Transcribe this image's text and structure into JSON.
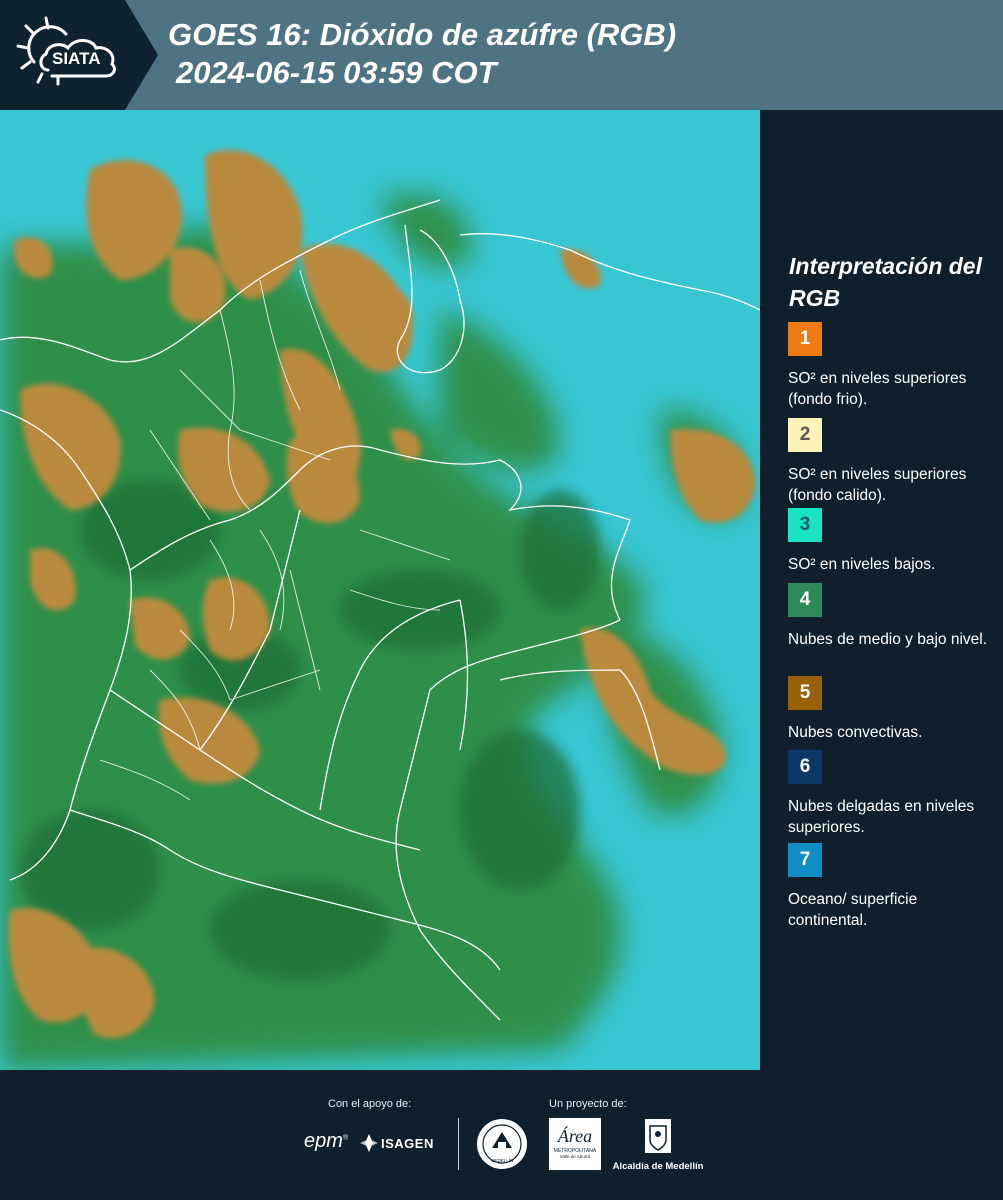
{
  "header": {
    "logo_text": "SIATA",
    "title_line1": "GOES 16: Dióxido de azúfre (RGB)",
    "title_line2": "2024-06-15 03:59 COT"
  },
  "legend": {
    "title": "Interpretación del RGB",
    "items": [
      {
        "number": "1",
        "color": "#f07a12",
        "text_color": "#ffffff",
        "description": "SO² en niveles superiores (fondo frio)."
      },
      {
        "number": "2",
        "color": "#fbf3b8",
        "text_color": "#5a5a5a",
        "description": "SO² en niveles superiores (fondo calido)."
      },
      {
        "number": "3",
        "color": "#18e3c5",
        "text_color": "#1b5e66",
        "description": "SO² en niveles bajos."
      },
      {
        "number": "4",
        "color": "#2f8a58",
        "text_color": "#ffffff",
        "description": "Nubes de medio y bajo nivel."
      },
      {
        "number": "5",
        "color": "#99600c",
        "text_color": "#ffffff",
        "description": "Nubes convectivas."
      },
      {
        "number": "6",
        "color": "#0d3767",
        "text_color": "#ffffff",
        "description": "Nubes delgadas en niveles superiores."
      },
      {
        "number": "7",
        "color": "#0f8dc4",
        "text_color": "#ffffff",
        "description": "Oceano/ superficie continental."
      }
    ]
  },
  "footer": {
    "support_label": "Con el apoyo de:",
    "project_label": "Un proyecto de:",
    "logo_epm": "epm",
    "logo_isagen": "ISAGEN",
    "logo_area_main": "Área",
    "logo_area_sub1": "METROPOLITANA",
    "logo_area_sub2": "Valle de Aburrá",
    "logo_alcaldia": "Alcaldía de Medellín",
    "logo_seal": "MEDELLÍN"
  },
  "colors": {
    "header_bg": "#4e7382",
    "panel_bg": "#0f1f2c",
    "map_cyan": "#38c6d3",
    "map_green": "#2f8a3a",
    "map_brown": "#b88a3a",
    "border_white": "#ffffff"
  }
}
